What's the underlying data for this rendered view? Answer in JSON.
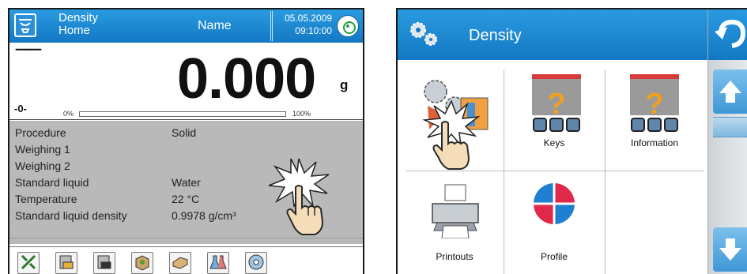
{
  "left_screen": {
    "header": {
      "mode_line1": "Density",
      "mode_line2": "Home",
      "user_name": "Name",
      "date": "05.05.2009",
      "time": "09:10:00"
    },
    "weighing": {
      "stability_marker": "⎺⎺",
      "value": "0.000",
      "unit": "g",
      "zero_indicator": "-0-",
      "progress_min_label": "0%",
      "progress_max_label": "100%",
      "progress_fraction": 0
    },
    "info_rows": [
      {
        "key": "Procedure",
        "value": "Solid"
      },
      {
        "key": "Weighing 1",
        "value": ""
      },
      {
        "key": "Weighing 2",
        "value": ""
      },
      {
        "key": "Standard liquid",
        "value": "Water"
      },
      {
        "key": "Temperature",
        "value": "22 °C"
      },
      {
        "key": "Standard liquid density",
        "value": "0.9978 g/cm³"
      }
    ],
    "function_keys": [
      {
        "icon": "tools-icon",
        "glyph": "⚒"
      },
      {
        "icon": "tare-weight-icon",
        "glyph": "▤"
      },
      {
        "icon": "sample-weight-icon",
        "glyph": "▤"
      },
      {
        "icon": "box-icon",
        "glyph": "◆"
      },
      {
        "icon": "solid-sample-icon",
        "glyph": "▱"
      },
      {
        "icon": "flasks-icon",
        "glyph": "⚗"
      },
      {
        "icon": "settings-wheel-icon",
        "glyph": "❀"
      }
    ]
  },
  "right_screen": {
    "header": {
      "title": "Density"
    },
    "tiles": [
      {
        "label": "",
        "icon": "settings-gears-icon"
      },
      {
        "label": "Keys",
        "icon": "keys-icon"
      },
      {
        "label": "Information",
        "icon": "information-icon"
      },
      {
        "label": "Printouts",
        "icon": "printer-icon"
      },
      {
        "label": "Profile",
        "icon": "profile-icon"
      }
    ]
  },
  "colors": {
    "header_blue": "#1e88d2",
    "info_gray": "#b9b9b9",
    "profile_red": "#e0284b",
    "profile_blue": "#1f7fd0"
  }
}
